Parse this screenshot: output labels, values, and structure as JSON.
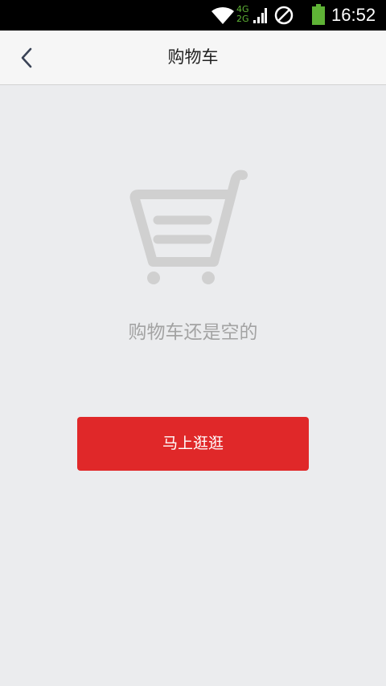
{
  "status_bar": {
    "network_type_top": "4G",
    "network_type_bottom": "2G",
    "time": "16:52",
    "icons": [
      "wifi-icon",
      "signal-icon",
      "do-not-disturb-icon",
      "battery-icon"
    ],
    "colors": {
      "network": "#5fb336",
      "battery": "#5fb336"
    }
  },
  "header": {
    "back_icon": "chevron-left-icon",
    "title": "购物车"
  },
  "empty_state": {
    "icon": "shopping-cart-icon",
    "message": "购物车还是空的",
    "button_label": "马上逛逛"
  },
  "colors": {
    "accent": "#e02829",
    "background": "#ebecee",
    "header_background": "#f6f6f6",
    "message_text": "#a3a3a3",
    "icon_gray": "#d0d0d0"
  }
}
